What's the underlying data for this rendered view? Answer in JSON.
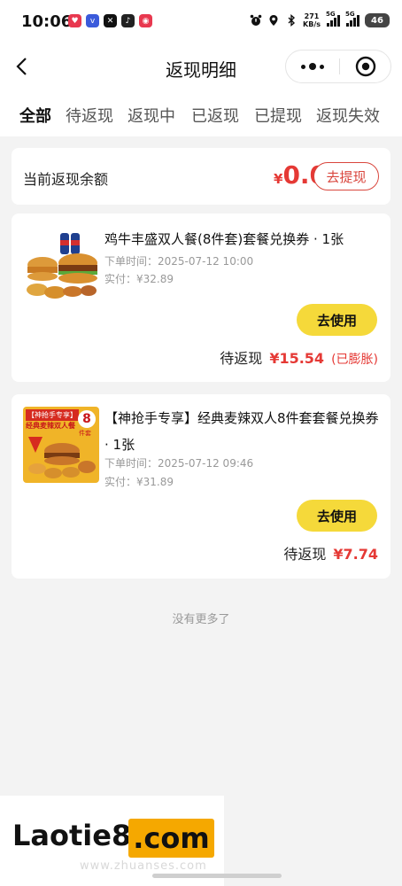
{
  "status_bar": {
    "time": "10:06",
    "app_icons": [
      {
        "name": "redapp-icon",
        "color": "#e8384f",
        "glyph": "♥"
      },
      {
        "name": "vivo-icon",
        "color": "#3b5bdb",
        "glyph": "v"
      },
      {
        "name": "capcut-icon",
        "color": "#111111",
        "glyph": "✕"
      },
      {
        "name": "dark-app-icon",
        "color": "#222222",
        "glyph": "♪"
      },
      {
        "name": "camera-app-icon",
        "color": "#e8384f",
        "glyph": "◉"
      }
    ],
    "network_speed_value": "271",
    "network_speed_unit": "KB/s",
    "signal_label_1": "5G",
    "signal_label_2": "5G",
    "battery": "46"
  },
  "nav": {
    "title": "返现明细"
  },
  "tabs": [
    {
      "label": "全部",
      "active": true
    },
    {
      "label": "待返现",
      "active": false
    },
    {
      "label": "返现中",
      "active": false
    },
    {
      "label": "已返现",
      "active": false
    },
    {
      "label": "已提现",
      "active": false
    },
    {
      "label": "返现失效",
      "active": false
    }
  ],
  "balance": {
    "label": "当前返现余额",
    "currency": "¥",
    "amount": "0.0",
    "withdraw_label": "去提现"
  },
  "orders": [
    {
      "name": "鸡牛丰盛双人餐(8件套)套餐兑换券 · 1张",
      "order_time": "下单时间：2025-07-12 10:00",
      "paid": "实付：¥32.89",
      "use_label": "去使用",
      "cashback_label": "待返现",
      "cashback_amount": "¥15.54",
      "cashback_note": "(已膨胀)"
    },
    {
      "name": "【神抢手专享】经典麦辣双人8件套套餐兑换券 · 1张",
      "order_time": "下单时间：2025-07-12 09:46",
      "paid": "实付：¥31.89",
      "use_label": "去使用",
      "cashback_label": "待返现",
      "cashback_amount": "¥7.74",
      "thumb_badge": "【神抢手专享】",
      "thumb_sub": "经典麦辣双人餐",
      "thumb_num": "8",
      "thumb_unit": "件套"
    }
  ],
  "footer": {
    "no_more": "没有更多了"
  },
  "watermark": {
    "logo": "Laotie8",
    "com": ".com",
    "sub": "www.zhuanses.com"
  },
  "colors": {
    "accent_red": "#e53935",
    "button_yellow": "#f5d93a",
    "watermark_orange": "#f5a800"
  }
}
